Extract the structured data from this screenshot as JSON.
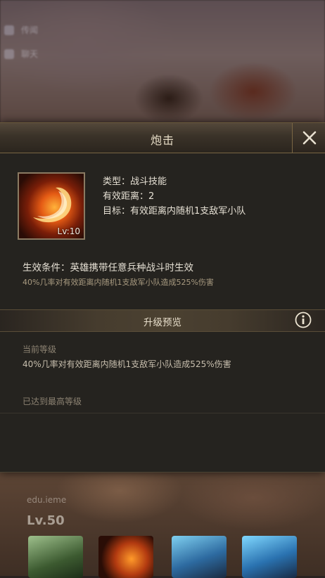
{
  "background": {
    "ghost_lines": [
      "传闻",
      "聊天"
    ],
    "hero_name": "edu.ieme",
    "hero_level": "Lv.50"
  },
  "dialog": {
    "title": "炮击",
    "close_icon": "close-x",
    "skill": {
      "icon": "fire-slash-icon",
      "level": "Lv:10",
      "type": "类型：战斗技能",
      "range": "有效距离：2",
      "target": "目标：有效距离内随机1支敌军小队"
    },
    "condition": "生效条件：英雄携带任意兵种战斗时生效",
    "condition_desc": "40%几率对有效距离内随机1支敌军小队造成525%伤害",
    "upgrade": {
      "section_title": "升级预览",
      "info_icon": "info-icon",
      "current_label": "当前等级",
      "current_desc": "40%几率对有效距离内随机1支敌军小队造成525%伤害",
      "max_level_text": "已达到最高等级"
    }
  },
  "colors": {
    "panel_bg": "#25231f",
    "gold_border": "#7a6644",
    "text_main": "#e6e0d4",
    "text_muted": "#8c8272"
  }
}
